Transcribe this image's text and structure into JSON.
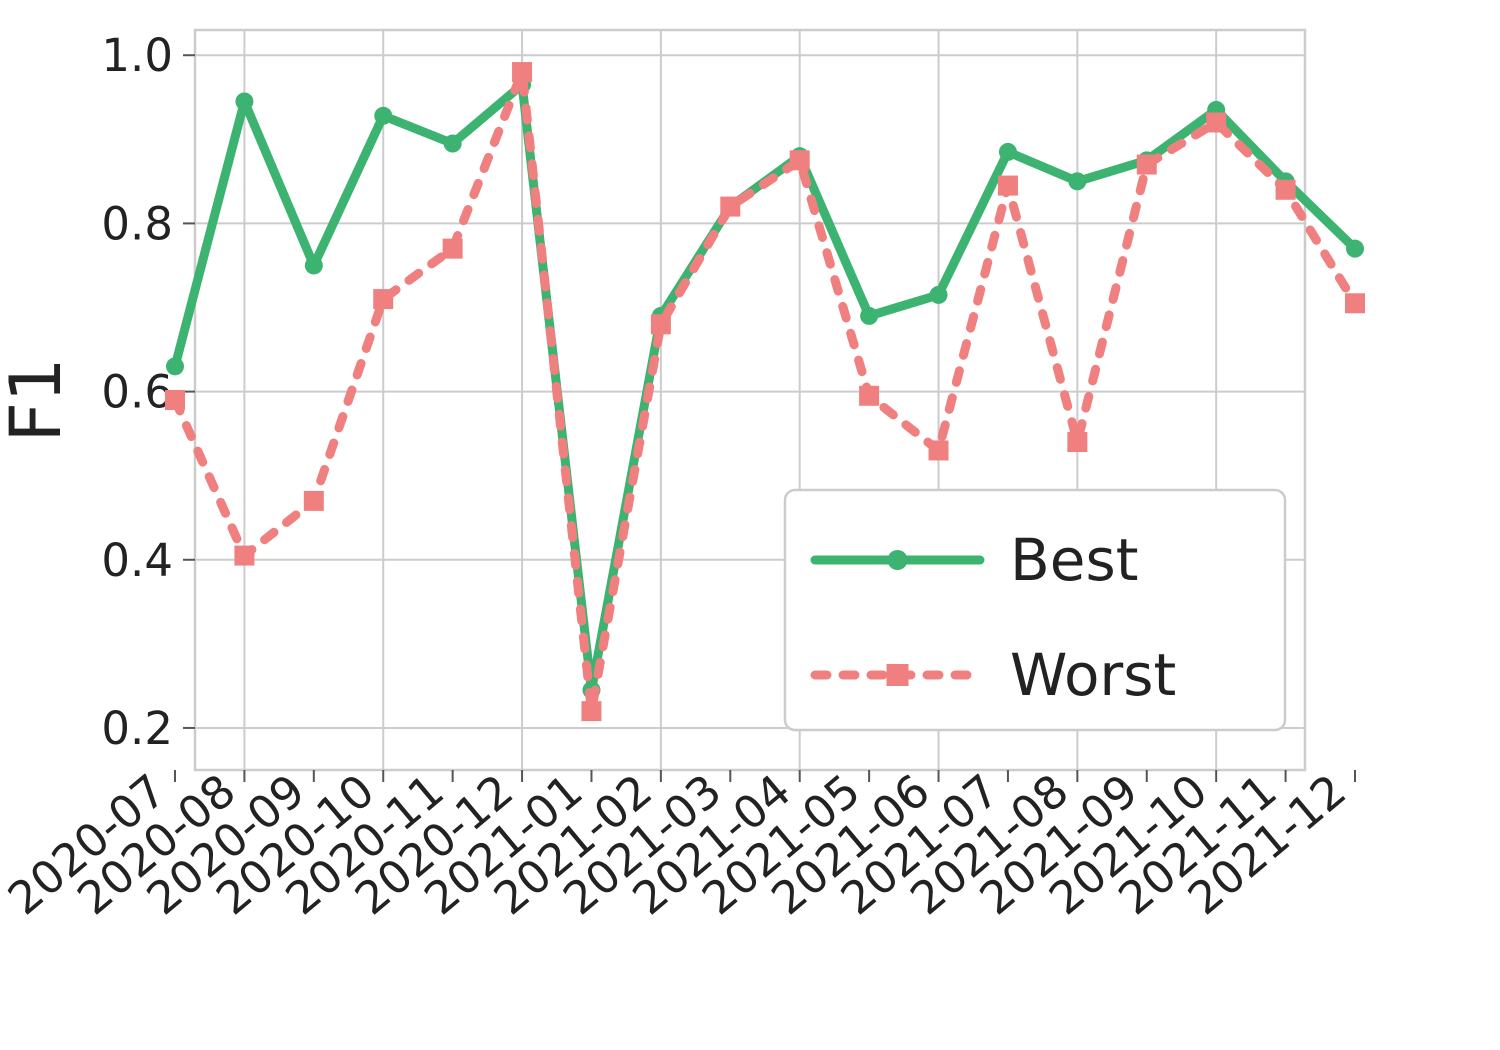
{
  "chart_data": {
    "type": "line",
    "title": "",
    "xlabel": "",
    "ylabel": "F1",
    "ylim": [
      0.15,
      1.03
    ],
    "yticks": [
      0.2,
      0.4,
      0.6,
      0.8,
      1.0
    ],
    "categories": [
      "2020-07",
      "2020-08",
      "2020-09",
      "2020-10",
      "2020-11",
      "2020-12",
      "2021-01",
      "2021-02",
      "2021-03",
      "2021-04",
      "2021-05",
      "2021-06",
      "2021-07",
      "2021-08",
      "2021-09",
      "2021-10",
      "2021-11",
      "2021-12"
    ],
    "series": [
      {
        "name": "Best",
        "color": "#3cb371",
        "style": "solid",
        "marker": "circle",
        "values": [
          0.63,
          0.945,
          0.75,
          0.928,
          0.895,
          0.965,
          0.245,
          0.69,
          0.82,
          0.88,
          0.69,
          0.715,
          0.885,
          0.85,
          0.875,
          0.935,
          0.85,
          0.77
        ]
      },
      {
        "name": "Worst",
        "color": "#f08080",
        "style": "dotted",
        "marker": "square",
        "values": [
          0.59,
          0.405,
          0.47,
          0.71,
          0.77,
          0.98,
          0.22,
          0.68,
          0.82,
          0.875,
          0.595,
          0.53,
          0.845,
          0.54,
          0.87,
          0.92,
          0.84,
          0.705
        ]
      }
    ],
    "legend_position": "lower-right",
    "grid": true
  },
  "colors": {
    "best": "#3cb371",
    "worst": "#f08080",
    "grid": "#cccccc"
  },
  "labels": {
    "ylabel": "F1",
    "legend_best": "Best",
    "legend_worst": "Worst"
  }
}
